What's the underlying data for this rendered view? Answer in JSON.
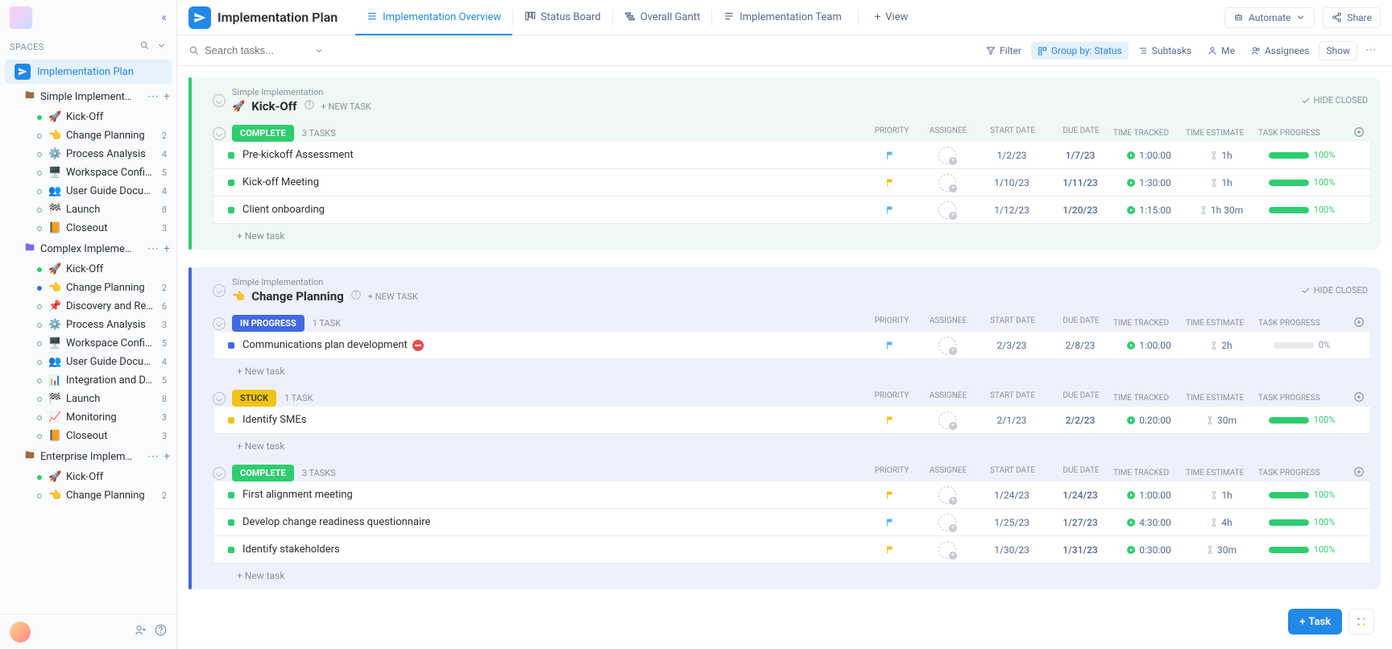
{
  "sidebar": {
    "spaces_label": "SPACES",
    "space": {
      "name": "Implementation Plan"
    },
    "folders": [
      {
        "name": "Simple Implement…",
        "theme": "default",
        "lists": [
          {
            "emoji": "🚀",
            "dot": "green",
            "name": "Kick-Off",
            "count": "",
            "muted": false
          },
          {
            "emoji": "👈",
            "dot": "",
            "name": "Change Planning",
            "count": "2"
          },
          {
            "emoji": "⚙️",
            "dot": "",
            "name": "Process Analysis",
            "count": "4",
            "muted": true
          },
          {
            "emoji": "🖥️",
            "dot": "",
            "name": "Workspace Confi…",
            "count": "5"
          },
          {
            "emoji": "👥",
            "dot": "",
            "name": "User Guide Docu…",
            "count": "4"
          },
          {
            "emoji": "🏁",
            "dot": "",
            "name": "Launch",
            "count": "8"
          },
          {
            "emoji": "📙",
            "dot": "",
            "name": "Closeout",
            "count": "3"
          }
        ]
      },
      {
        "name": "Complex Impleme…",
        "theme": "purple",
        "lists": [
          {
            "emoji": "🚀",
            "dot": "green",
            "name": "Kick-Off",
            "count": ""
          },
          {
            "emoji": "👈",
            "dot": "blue",
            "name": "Change Planning",
            "count": "2"
          },
          {
            "emoji": "📌",
            "dot": "",
            "name": "Discovery and Re…",
            "count": "6"
          },
          {
            "emoji": "⚙️",
            "dot": "",
            "name": "Process Analysis",
            "count": "3",
            "muted": true
          },
          {
            "emoji": "🖥️",
            "dot": "",
            "name": "Workspace Confi…",
            "count": "5"
          },
          {
            "emoji": "👥",
            "dot": "",
            "name": "User Guide Docu…",
            "count": "4"
          },
          {
            "emoji": "📊",
            "dot": "",
            "name": "Integration and D…",
            "count": "5"
          },
          {
            "emoji": "🏁",
            "dot": "",
            "name": "Launch",
            "count": "8"
          },
          {
            "emoji": "📈",
            "dot": "",
            "name": "Monitoring",
            "count": "3"
          },
          {
            "emoji": "📙",
            "dot": "",
            "name": "Closeout",
            "count": "3"
          }
        ]
      },
      {
        "name": "Enterprise Implem…",
        "theme": "default",
        "lists": [
          {
            "emoji": "🚀",
            "dot": "green",
            "name": "Kick-Off",
            "count": ""
          },
          {
            "emoji": "👈",
            "dot": "",
            "name": "Change Planning",
            "count": "2"
          }
        ]
      }
    ]
  },
  "header": {
    "title": "Implementation Plan",
    "views": [
      {
        "name": "Implementation Overview",
        "active": true
      },
      {
        "name": "Status Board"
      },
      {
        "name": "Overall Gantt"
      },
      {
        "name": "Implementation Team"
      }
    ],
    "add_view_label": "View",
    "automate_label": "Automate",
    "share_label": "Share"
  },
  "toolbar": {
    "search_placeholder": "Search tasks...",
    "filter_label": "Filter",
    "group_label": "Group by: Status",
    "subtasks_label": "Subtasks",
    "me_label": "Me",
    "assignees_label": "Assignees",
    "show_label": "Show"
  },
  "columns": {
    "priority": "PRIORITY",
    "assignee": "ASSIGNEE",
    "start_date": "START DATE",
    "due_date": "DUE DATE",
    "time_tracked": "TIME TRACKED",
    "time_estimate": "TIME ESTIMATE",
    "task_progress": "TASK PROGRESS"
  },
  "groups": [
    {
      "crumb": "Simple Implementation",
      "emoji": "🚀",
      "title": "Kick-Off",
      "new_task_label": "+ NEW TASK",
      "hide_label": "HIDE CLOSED",
      "bg": "green",
      "statuses": [
        {
          "label": "COMPLETE",
          "color": "green",
          "count": "3 TASKS",
          "tasks": [
            {
              "name": "Pre-kickoff Assessment",
              "sq": "green",
              "priority": "blue",
              "start": "1/2/23",
              "due": "1/7/23",
              "tracked": "1:00:00",
              "estimate": "1h",
              "progress": 100,
              "blocked": false
            },
            {
              "name": "Kick-off Meeting",
              "sq": "green",
              "priority": "yellow",
              "start": "1/10/23",
              "due": "1/11/23",
              "tracked": "1:30:00",
              "estimate": "1h",
              "progress": 100,
              "blocked": false
            },
            {
              "name": "Client onboarding",
              "sq": "green",
              "priority": "blue",
              "start": "1/12/23",
              "due": "1/20/23",
              "tracked": "1:15:00",
              "estimate": "1h 30m",
              "progress": 100,
              "blocked": false
            }
          ]
        }
      ]
    },
    {
      "crumb": "Simple Implementation",
      "emoji": "👈",
      "title": "Change Planning",
      "new_task_label": "+ NEW TASK",
      "hide_label": "HIDE CLOSED",
      "bg": "blue",
      "statuses": [
        {
          "label": "IN PROGRESS",
          "color": "blue",
          "count": "1 TASK",
          "tasks": [
            {
              "name": "Communications plan development",
              "sq": "blue",
              "priority": "blue",
              "start": "2/3/23",
              "due": "2/8/23",
              "due_green": false,
              "tracked": "1:00:00",
              "estimate": "2h",
              "progress": 0,
              "blocked": true
            }
          ]
        },
        {
          "label": "STUCK",
          "color": "yellow",
          "count": "1 TASK",
          "tasks": [
            {
              "name": "Identify SMEs",
              "sq": "yellow",
              "priority": "yellow",
              "start": "2/1/23",
              "due": "2/2/23",
              "tracked": "0:20:00",
              "estimate": "30m",
              "progress": 100,
              "blocked": false
            }
          ]
        },
        {
          "label": "COMPLETE",
          "color": "green",
          "count": "3 TASKS",
          "tasks": [
            {
              "name": "First alignment meeting",
              "sq": "green",
              "priority": "yellow",
              "start": "1/24/23",
              "due": "1/24/23",
              "tracked": "1:00:00",
              "estimate": "1h",
              "progress": 100,
              "blocked": false
            },
            {
              "name": "Develop change readiness questionnaire",
              "sq": "green",
              "priority": "blue",
              "start": "1/25/23",
              "due": "1/27/23",
              "tracked": "4:30:00",
              "estimate": "4h",
              "progress": 100,
              "blocked": false
            },
            {
              "name": "Identify stakeholders",
              "sq": "green",
              "priority": "yellow",
              "start": "1/30/23",
              "due": "1/31/23",
              "tracked": "0:30:00",
              "estimate": "30m",
              "progress": 100,
              "blocked": false
            }
          ]
        }
      ]
    }
  ],
  "new_task_row_label": "+ New task",
  "fab_task_label": "Task"
}
